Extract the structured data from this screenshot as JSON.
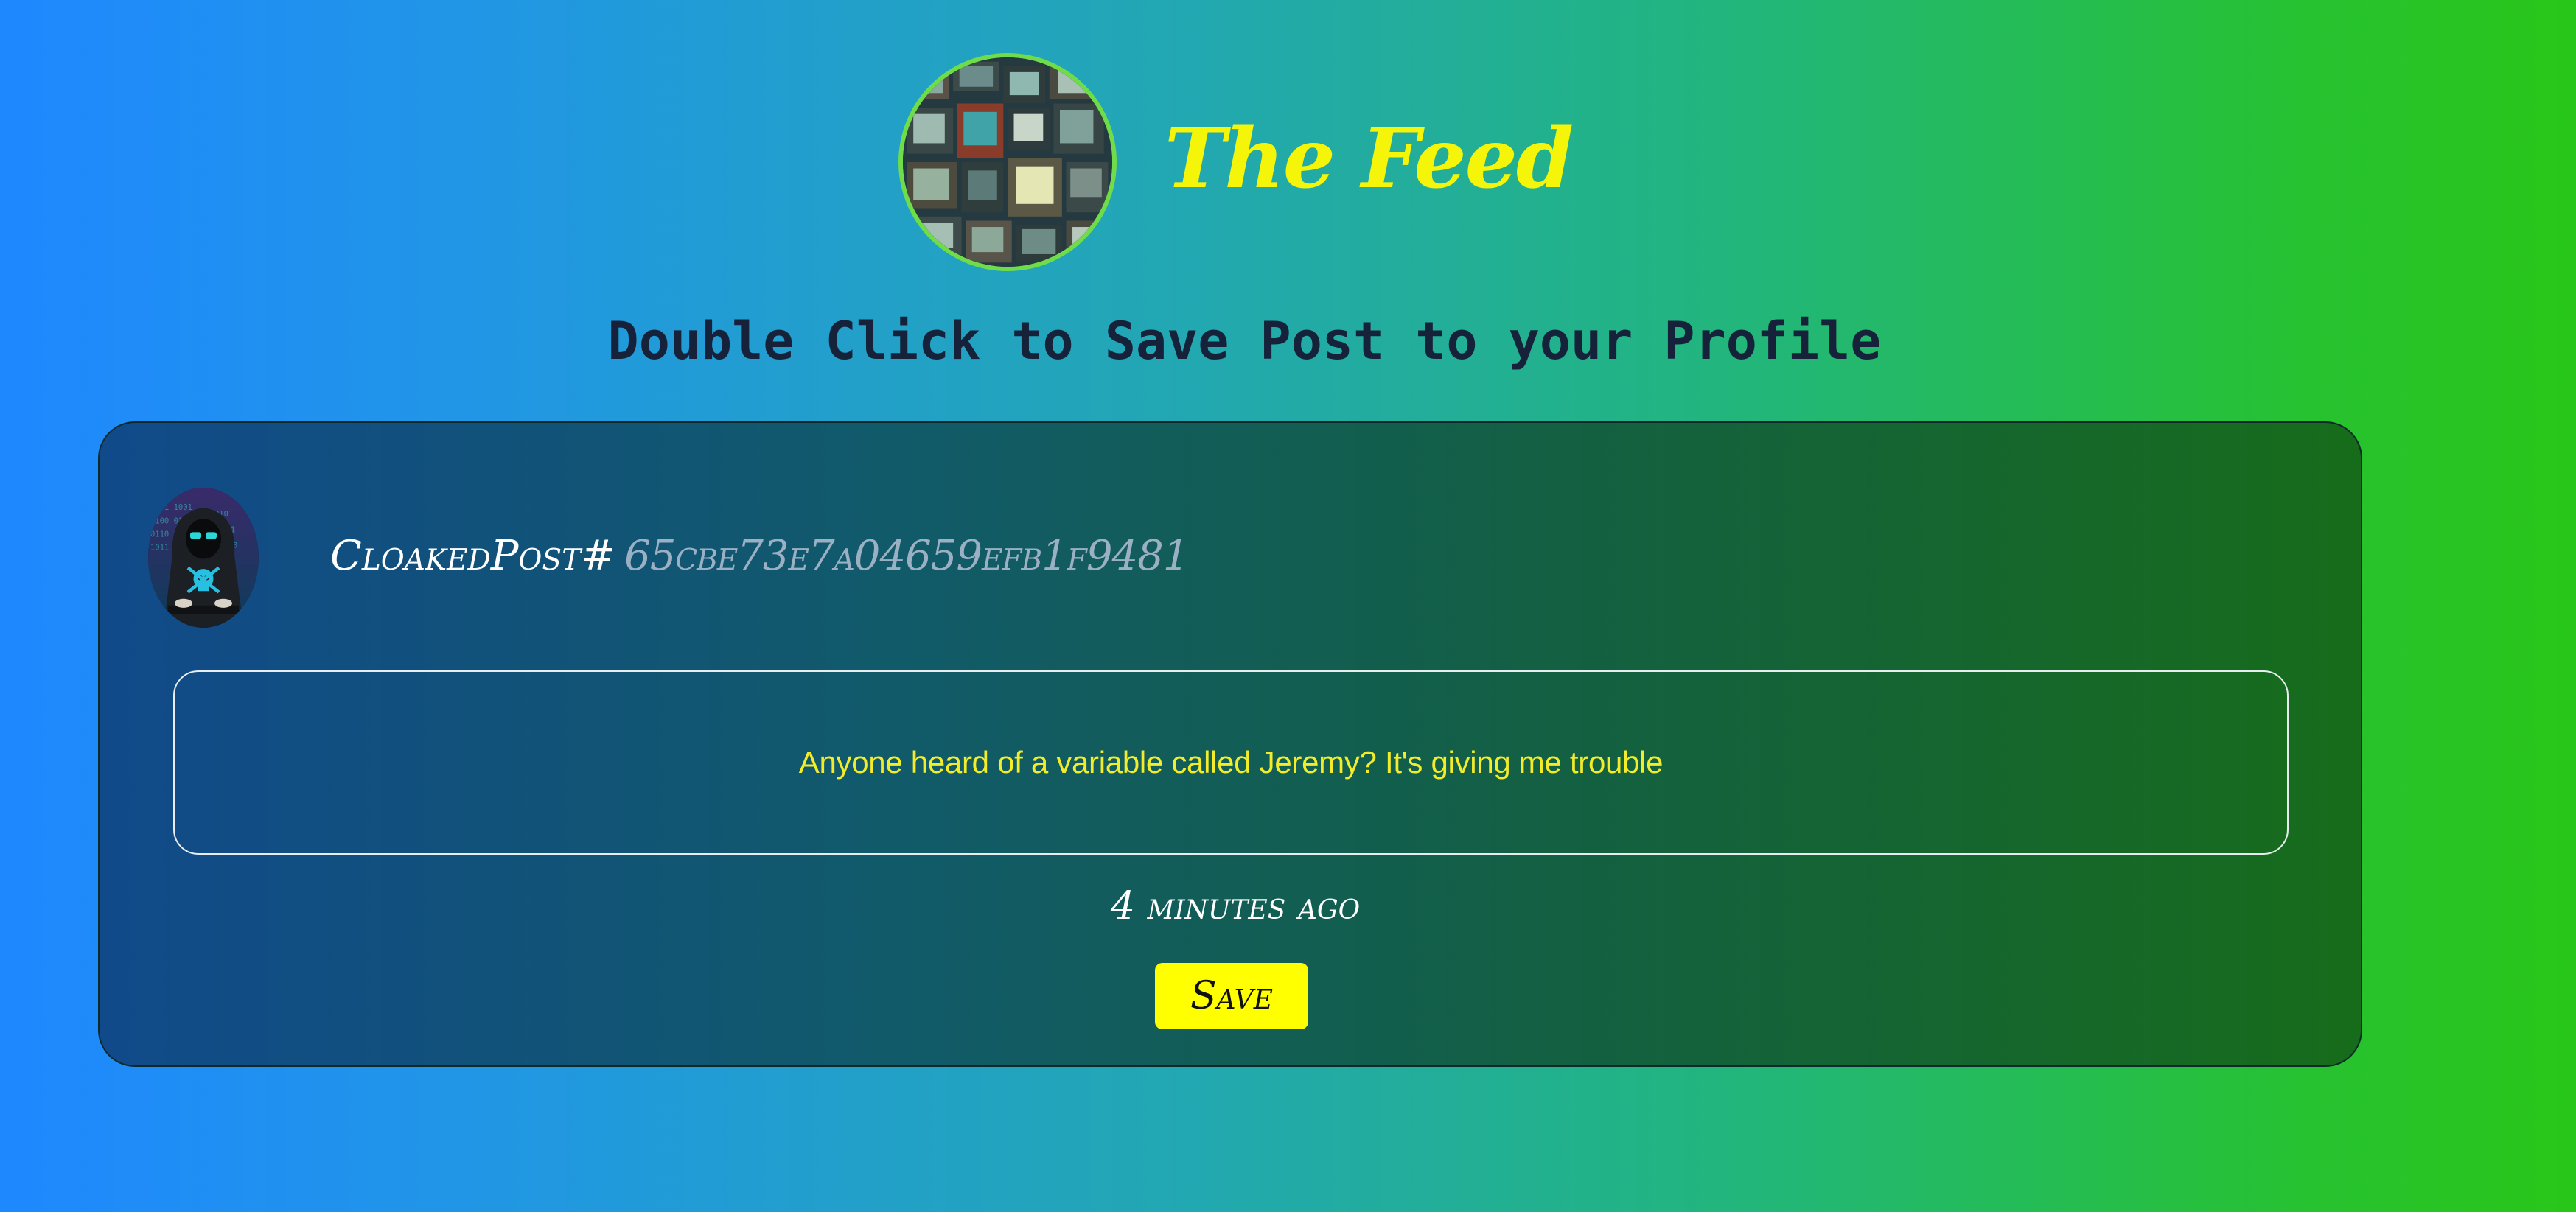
{
  "header": {
    "logo_icon": "vintage-tv-wall-logo",
    "title": "The Feed",
    "instruction": "Double Click to Save Post to your Profile"
  },
  "post": {
    "avatar_icon": "hooded-hacker-avatar",
    "id_label": "CloakedPost#",
    "id_value": "65cbe73e7a04659efb1f9481",
    "content": "Anyone heard of a variable called Jeremy? It's giving me trouble",
    "timestamp": "4 minutes ago",
    "save_label": "Save"
  },
  "colors": {
    "title": "#f5f50a",
    "post_text": "#f2ec2a",
    "save_button": "#ffff00",
    "logo_ring": "#6fdc4a"
  }
}
